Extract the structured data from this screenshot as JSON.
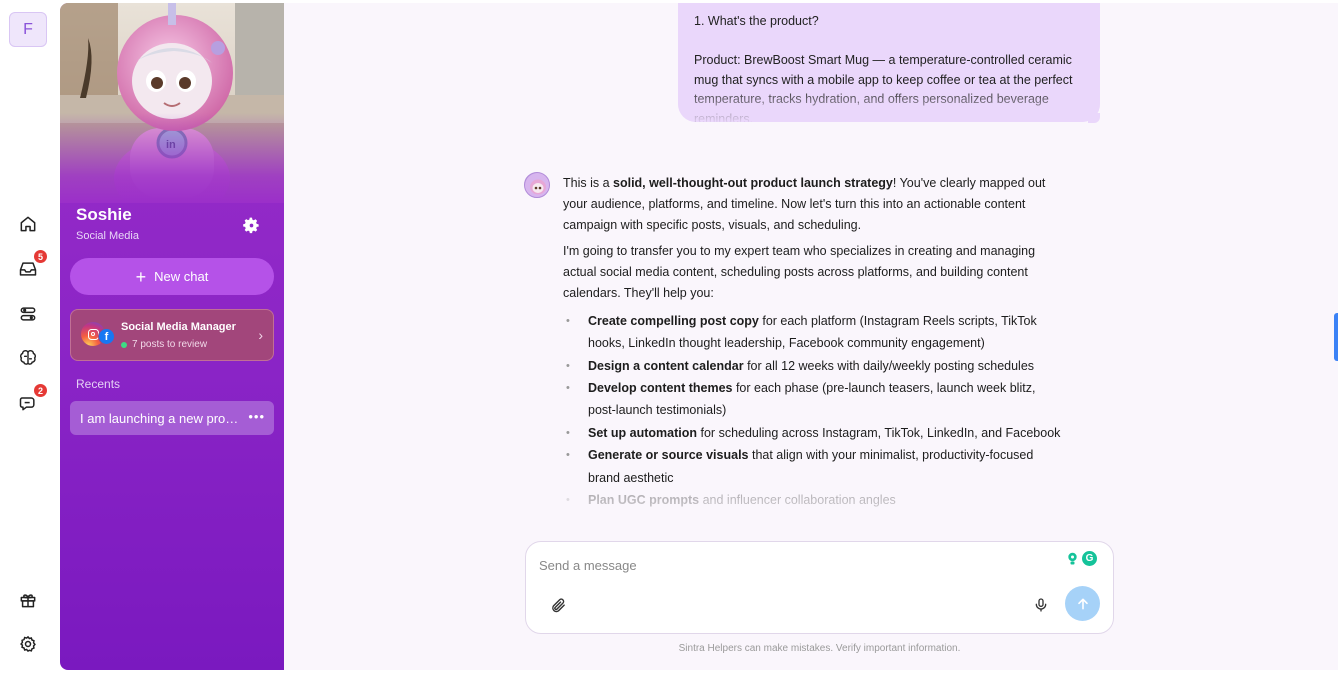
{
  "rail": {
    "workspace_initial": "F",
    "inbox_badge": "5",
    "chat_badge": "2"
  },
  "sidebar": {
    "agent_name": "Soshie",
    "agent_role": "Social Media",
    "new_chat_label": "New chat",
    "team_card": {
      "title": "Social Media Manager",
      "subtitle": "7 posts to review"
    },
    "recents_label": "Recents",
    "recents": [
      {
        "title": "I am launching a new prod..."
      }
    ]
  },
  "conversation": {
    "user_message": {
      "line1": "1. What's the product?",
      "product_label": "Product: BrewBoost Smart Mug — a temperature-controlled ceramic mug that syncs with a mobile app to keep coffee or tea at the perfect temperature, tracks hydration, and offers personalized beverage reminders."
    },
    "assistant_message": {
      "p1_prefix": "This is a ",
      "p1_bold": "solid, well-thought-out product launch strategy",
      "p1_suffix": "! You've clearly mapped out your audience, platforms, and timeline. Now let's turn this into an actionable content campaign with specific posts, visuals, and scheduling.",
      "p2": "I'm going to transfer you to my expert team who specializes in creating and managing actual social media content, scheduling posts across platforms, and building content calendars. They'll help you:",
      "bullets": [
        {
          "bold": "Create compelling post copy",
          "text": " for each platform (Instagram Reels scripts, TikTok hooks, LinkedIn thought leadership, Facebook community engagement)"
        },
        {
          "bold": "Design a content calendar",
          "text": " for all 12 weeks with daily/weekly posting schedules"
        },
        {
          "bold": "Develop content themes",
          "text": " for each phase (pre-launch teasers, launch week blitz, post-launch testimonials)"
        },
        {
          "bold": "Set up automation",
          "text": " for scheduling across Instagram, TikTok, LinkedIn, and Facebook"
        },
        {
          "bold": "Generate or source visuals",
          "text": " that align with your minimalist, productivity-focused brand aesthetic"
        },
        {
          "bold": "Plan UGC prompts",
          "text": " and influencer collaboration angles"
        }
      ]
    }
  },
  "composer": {
    "placeholder": "Send a message",
    "value": "",
    "disclaimer": "Sintra Helpers can make mistakes. Verify important information."
  },
  "colors": {
    "sidebar": "#8a24c6",
    "new_chat": "#b552e8",
    "user_bubble": "#ead7fb",
    "send_button": "#a6d2f8",
    "badge": "#e53935"
  },
  "icons": {
    "rail": [
      "home-icon",
      "inbox-icon",
      "apps-icon",
      "brain-icon",
      "chat-bubble-icon",
      "gift-icon",
      "settings-icon"
    ],
    "composer": [
      "paperclip-icon",
      "microphone-icon",
      "arrow-up-icon"
    ]
  }
}
